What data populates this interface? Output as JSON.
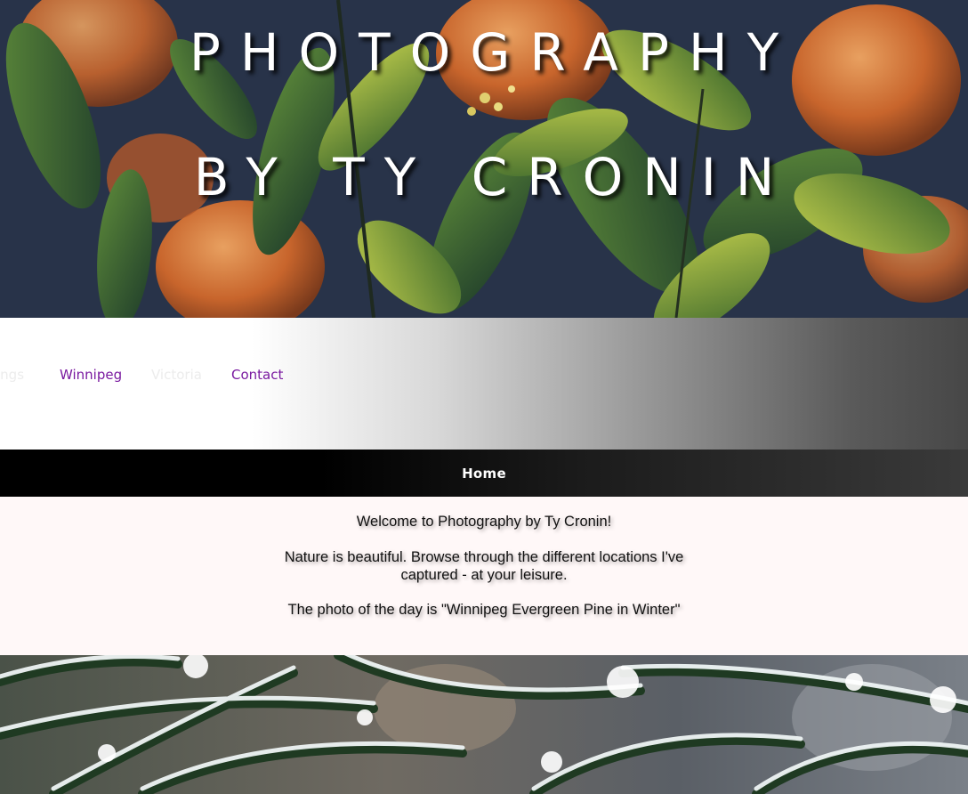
{
  "header": {
    "title_line1": "PHOTOGRAPHY",
    "title_line2": "BY TY CRONIN"
  },
  "nav": {
    "items": [
      {
        "label": "ings",
        "faded": true
      },
      {
        "label": "Winnipeg",
        "faded": false
      },
      {
        "label": "Victoria",
        "faded": true
      },
      {
        "label": "Contact",
        "faded": false
      }
    ]
  },
  "home_bar": {
    "label": "Home"
  },
  "welcome": {
    "line1": "Welcome to Photography by Ty Cronin!",
    "line2": "Nature is beautiful. Browse through the different locations I've captured - at your leisure.",
    "line3": "The photo of the day is \"Winnipeg Evergreen Pine in Winter\""
  },
  "colors": {
    "nav_link": "#7a1aa0",
    "home_bar": "#000000",
    "welcome_bg": "#fff8f8"
  }
}
